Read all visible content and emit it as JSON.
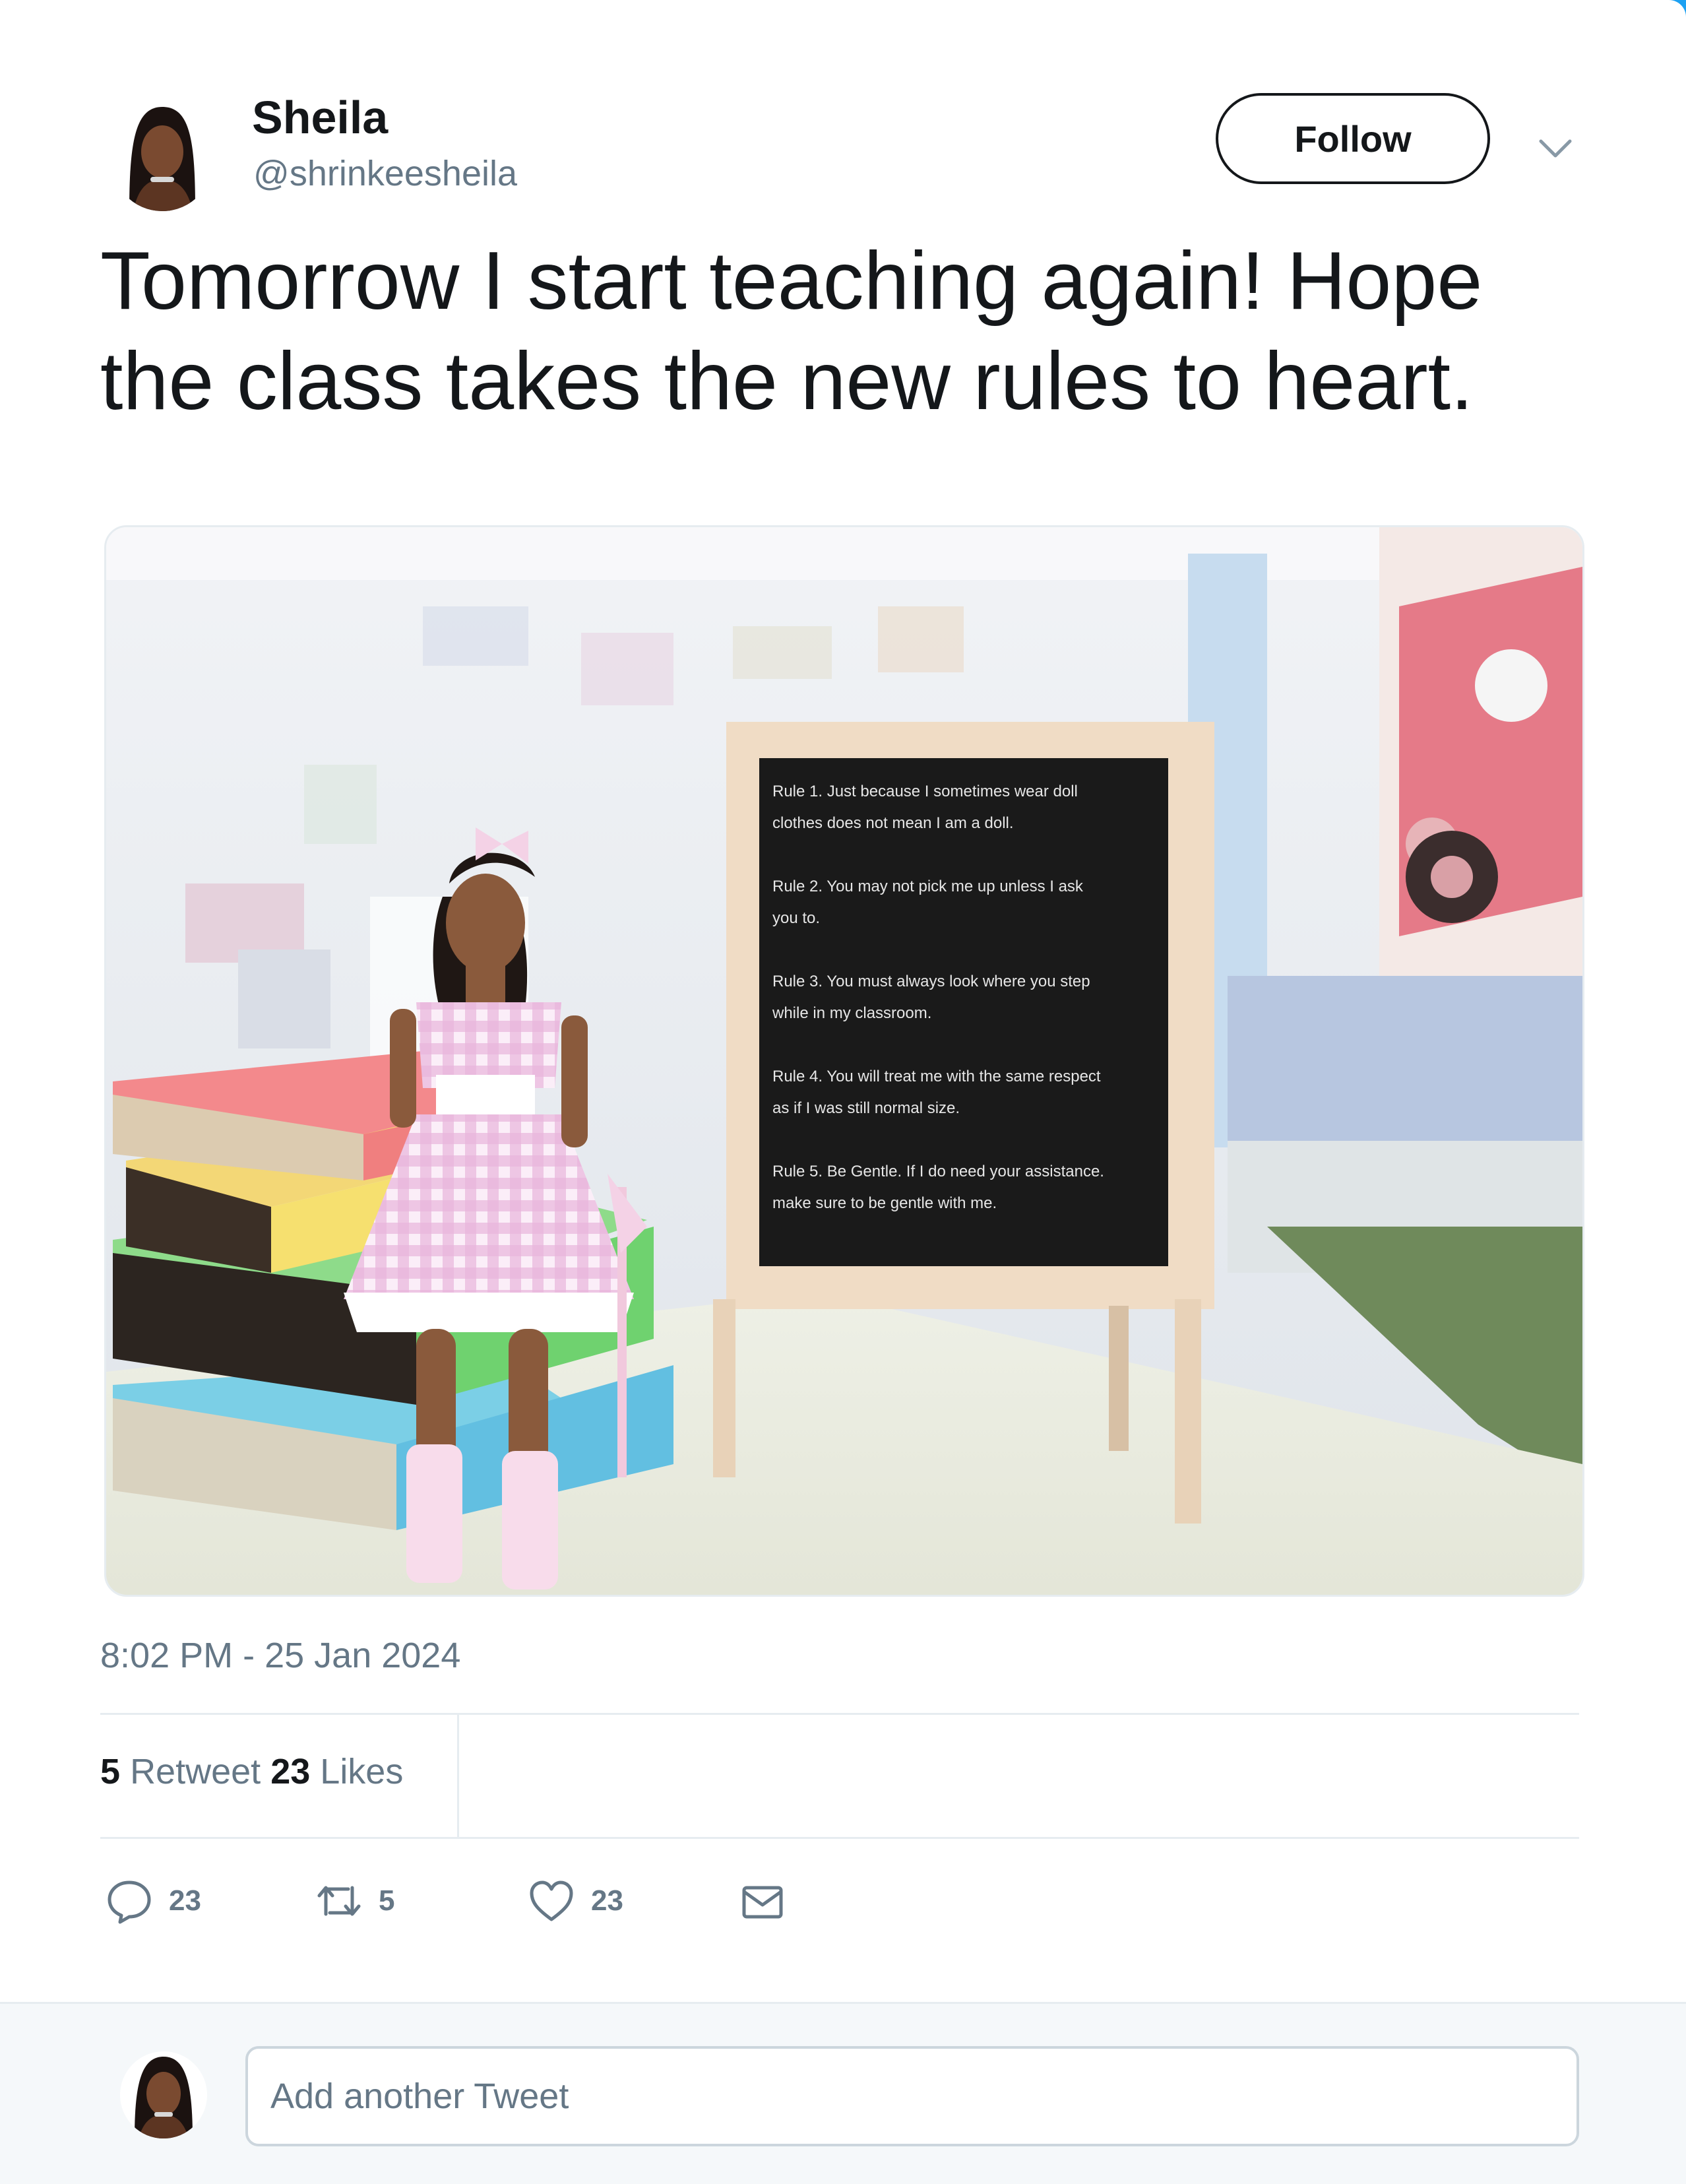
{
  "user": {
    "display_name": "Sheila",
    "handle": "@shrinkeesheila"
  },
  "header": {
    "follow_label": "Follow"
  },
  "tweet": {
    "text": "Tomorrow I start teaching again! Hope the class takes the new rules to heart.",
    "timestamp": "8:02 PM - 25 Jan 2024"
  },
  "media": {
    "chalkboard_lines": [
      "Rule 1. Just because I sometimes wear doll",
      "clothes does not mean I am a doll.",
      "Rule 2. You may not pick me up unless I ask",
      "you to.",
      "Rule 3. You must always look where you step",
      "while in my classroom.",
      "Rule 4. You will treat me with the same respect",
      "as if I was still normal size.",
      "Rule 5. Be Gentle. If I do need your assistance.",
      "make sure to be gentle with me."
    ]
  },
  "stats": {
    "retweet_count": "5",
    "retweet_label": "Retweet",
    "like_count": "23",
    "like_label": "Likes"
  },
  "actions": {
    "reply_count": "23",
    "retweet_count": "5",
    "like_count": "23"
  },
  "reply": {
    "placeholder": "Add another Tweet"
  },
  "colors": {
    "accent": "#1da1f2",
    "text": "#14171a",
    "muted": "#657786",
    "border": "#e6ecf0"
  }
}
